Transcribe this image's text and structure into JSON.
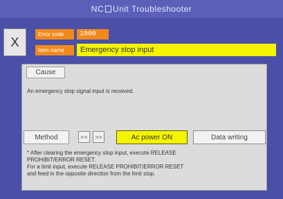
{
  "window": {
    "title_prefix": "NC",
    "title_suffix": "Unit  Troubleshooter"
  },
  "header": {
    "close_label": "X",
    "error_code_label": "Error code",
    "error_code_value": "1000",
    "item_name_label": "Item name",
    "item_name_value": "Emergency stop input"
  },
  "cause": {
    "tab_label": "Cause",
    "text": "An emergency stop signal input is received."
  },
  "method": {
    "label": "Method",
    "prev_label": "<<",
    "next_label": ">>",
    "power_button_label": "Ac power ON",
    "data_button_label": "Data writing",
    "lines": [
      "* After clearing the emergency stop input, execute RELEASE",
      "PROHIBIT/ERROR RESET.",
      "For a limit input, execute RELEASE PROHIBIT/ERROR RESET",
      "and feed in the opposite direction from the limit stop."
    ]
  },
  "colors": {
    "background": "#4a4fa8",
    "accent_orange": "#f08a1c",
    "highlight_yellow": "#f4f400",
    "panel_gray": "#dcdcdc"
  }
}
